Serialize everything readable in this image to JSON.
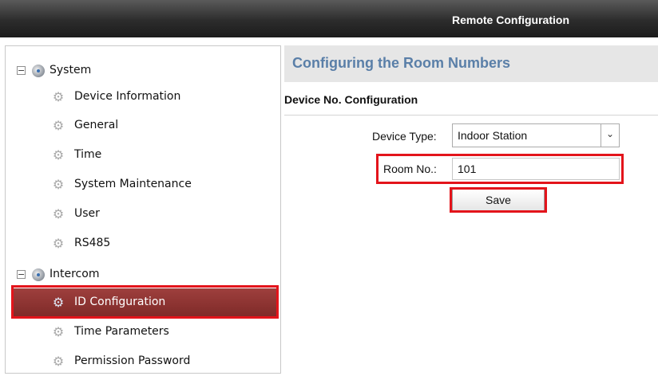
{
  "window": {
    "title": "Remote Configuration"
  },
  "sidebar": {
    "groups": [
      {
        "label": "System",
        "expanded": true,
        "toggle": "−",
        "icon": "group-icon",
        "items": [
          {
            "label": "Device Information",
            "icon": "gear-icon"
          },
          {
            "label": "General",
            "icon": "gear-icon"
          },
          {
            "label": "Time",
            "icon": "gear-icon"
          },
          {
            "label": "System Maintenance",
            "icon": "gear-icon"
          },
          {
            "label": "User",
            "icon": "gear-icon"
          },
          {
            "label": "RS485",
            "icon": "gear-icon"
          }
        ]
      },
      {
        "label": "Intercom",
        "expanded": true,
        "toggle": "−",
        "icon": "group-icon",
        "items": [
          {
            "label": "ID Configuration",
            "icon": "gear-icon",
            "selected": true
          },
          {
            "label": "Time Parameters",
            "icon": "gear-icon"
          },
          {
            "label": "Permission Password",
            "icon": "gear-icon"
          }
        ]
      }
    ]
  },
  "main": {
    "header": "Configuring the Room Numbers",
    "section_title": "Device No. Configuration",
    "device_type": {
      "label": "Device Type:",
      "value": "Indoor Station"
    },
    "room_no": {
      "label": "Room No.:",
      "value": "101"
    },
    "save_label": "Save"
  },
  "colors": {
    "selected_row": "#8a3230",
    "highlight_box": "#e3141b",
    "header_text": "#5a7fa8"
  }
}
